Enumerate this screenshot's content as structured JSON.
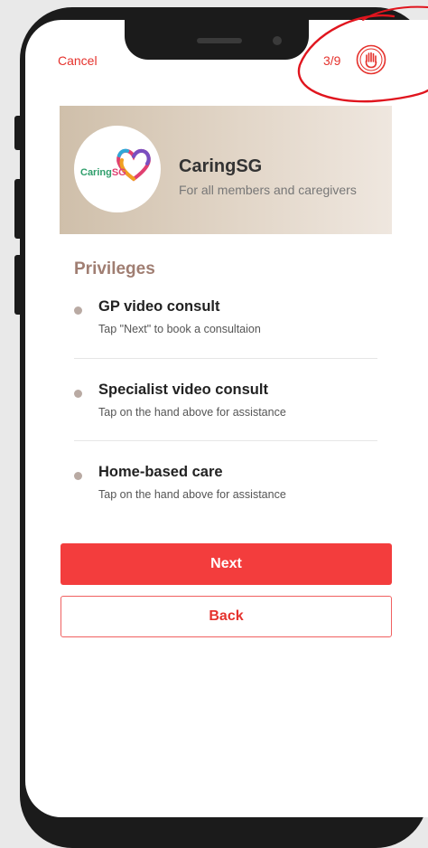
{
  "header": {
    "cancel_label": "Cancel",
    "step": "3/9",
    "help_icon": "raised-hand-icon"
  },
  "banner": {
    "logo_text_caring": "Caring",
    "logo_text_sg": "SG",
    "title": "CaringSG",
    "subtitle": "For all members and caregivers"
  },
  "privileges": {
    "heading": "Privileges",
    "items": [
      {
        "title": "GP video consult",
        "subtitle": "Tap \"Next\" to book a consultaion"
      },
      {
        "title": "Specialist video consult",
        "subtitle": "Tap on the hand above for assistance"
      },
      {
        "title": "Home-based care",
        "subtitle": "Tap on the hand above for assistance"
      }
    ]
  },
  "actions": {
    "next_label": "Next",
    "back_label": "Back"
  },
  "colors": {
    "accent": "#f33d3d",
    "heading": "#a07e72",
    "annotation": "#e0151e"
  }
}
